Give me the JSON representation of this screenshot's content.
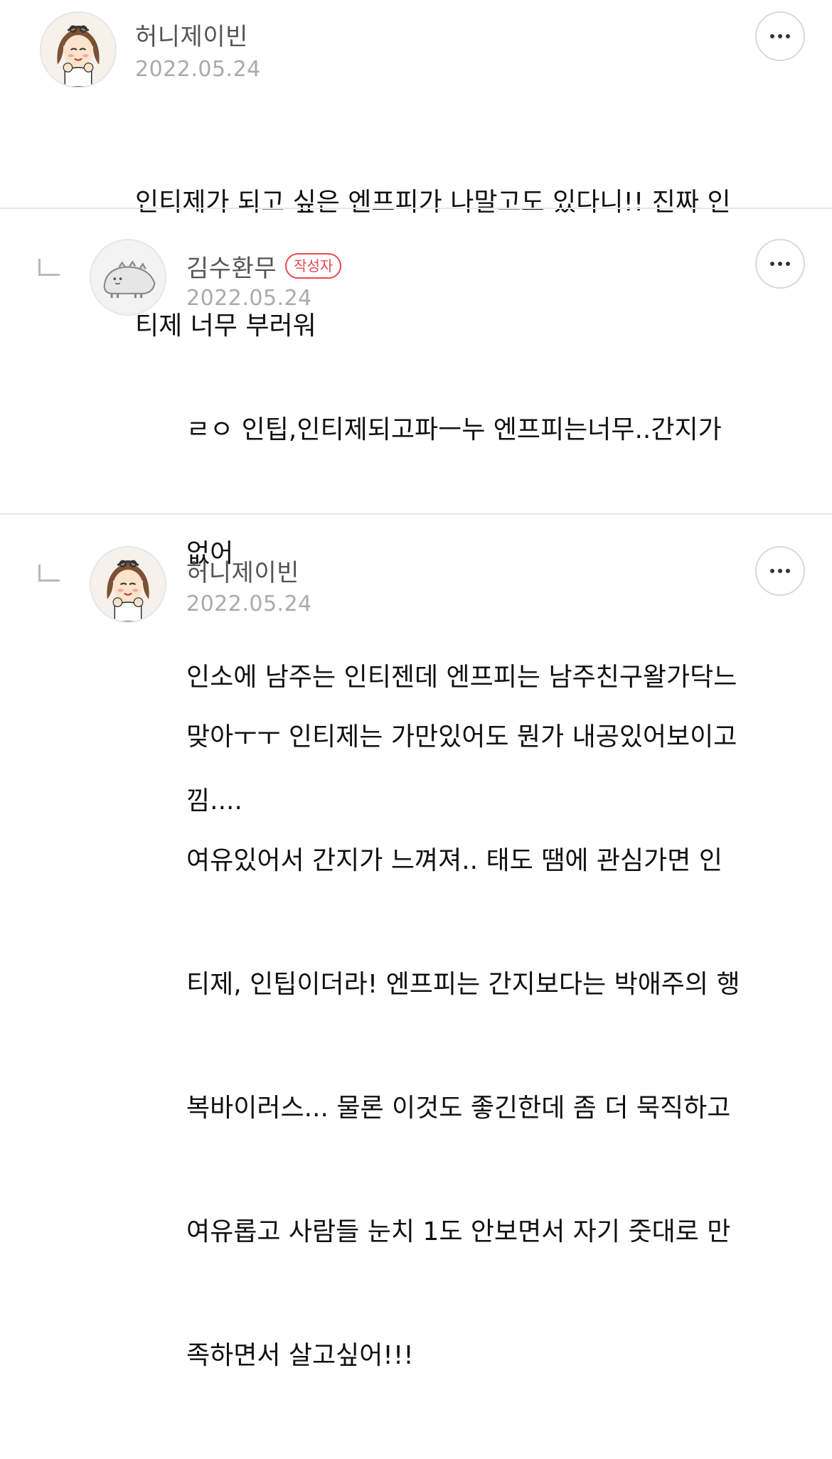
{
  "comments": [
    {
      "author": "허니제이빈",
      "date": "2022.05.24",
      "is_reply": false,
      "badge": "",
      "avatar": "girl-avatar-icon",
      "lines": [
        "인티제가 되고 싶은 엔프피가 나말고도 있다니!! 진짜 인",
        "티제 너무 부러워"
      ]
    },
    {
      "author": "김수환무",
      "date": "2022.05.24",
      "is_reply": true,
      "badge": "작성자",
      "avatar": "dinosaur-avatar-icon",
      "lines": [
        "ㄹㅇ 인팁,인티제되고파ㅡ누 엔프피는너무..간지가",
        "없어",
        "인소에 남주는 인티젠데 엔프피는 남주친구왈가닥느",
        "낌...."
      ]
    },
    {
      "author": "허니제이빈",
      "date": "2022.05.24",
      "is_reply": true,
      "badge": "",
      "avatar": "girl-avatar-icon",
      "lines": [
        "맞아ㅜㅜ 인티제는 가만있어도 뭔가 내공있어보이고",
        "여유있어서 간지가 느껴져.. 태도 땜에 관심가면 인",
        "티제, 인팁이더라! 엔프피는 간지보다는 박애주의 행",
        "복바이러스... 물론 이것도 좋긴한데 좀 더 묵직하고",
        "여유롭고 사람들 눈치 1도 안보면서 자기 줏대로 만",
        "족하면서 살고싶어!!!"
      ]
    }
  ],
  "colors": {
    "badge": "#e8474f",
    "name": "#555555",
    "date": "#aaaaaa",
    "divider": "#e8e8e8"
  }
}
